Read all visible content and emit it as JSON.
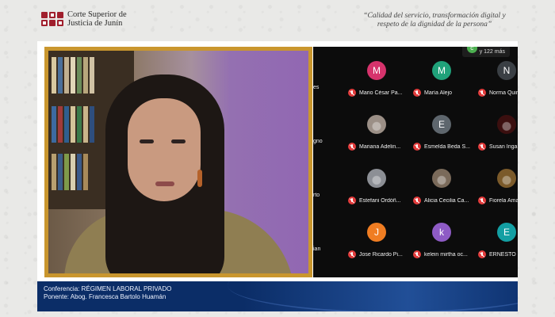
{
  "header": {
    "logo_line1": "Corte Superior de",
    "logo_line2": "Justicia de Junín",
    "motto_line1": "“Calidad del servicio, transformación digital y",
    "motto_line2": "respeto de la dignidad de la persona”"
  },
  "gallery": {
    "count_avatar": "c",
    "count_label": "y 122 más",
    "edge_names": [
      "es",
      "gno",
      "rto",
      "ian"
    ],
    "participants": [
      {
        "initial": "M",
        "color": "#d6336c",
        "name": "Mario César Pa...",
        "photo": false
      },
      {
        "initial": "M",
        "color": "#20a27a",
        "name": "María Alejo",
        "photo": false
      },
      {
        "initial": "N",
        "color": "#3a3f44",
        "name": "Norma Quintani...",
        "photo": false
      },
      {
        "initial": "",
        "color": "#9b8f86",
        "name": "Mariana Adelin...",
        "photo": true
      },
      {
        "initial": "E",
        "color": "#5e666d",
        "name": "Esmelda Beda S...",
        "photo": false
      },
      {
        "initial": "",
        "color": "#3b0f0f",
        "name": "Susan Inga Ca...",
        "photo": true
      },
      {
        "initial": "",
        "color": "#8c8f95",
        "name": "Estefani Ordóñ...",
        "photo": true
      },
      {
        "initial": "",
        "color": "#7a6a5a",
        "name": "Alicia Cecilia Ca...",
        "photo": true
      },
      {
        "initial": "",
        "color": "#7b5a2a",
        "name": "Fiorela Amaro C...",
        "photo": true
      },
      {
        "initial": "J",
        "color": "#f07d22",
        "name": "Jose Ricardo Pi...",
        "photo": false
      },
      {
        "initial": "k",
        "color": "#8e5bc5",
        "name": "kelein mirtha oc...",
        "photo": false
      },
      {
        "initial": "E",
        "color": "#139fa3",
        "name": "ERNESTO DIES...",
        "photo": false
      }
    ],
    "right_edge": [
      "Xio",
      "Kat",
      "Jua",
      "And"
    ]
  },
  "footer": {
    "conference": "Conferencia: RÉGIMEN LABORAL PRIVADO",
    "speaker": "Ponente: Abog. Francesca Bartolo Huamán"
  }
}
